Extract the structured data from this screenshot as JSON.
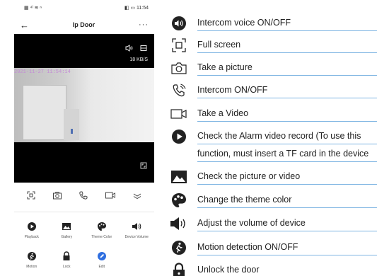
{
  "phone": {
    "status_left": "▦ ⁴ˡ ≋ ⁿ",
    "status_right": "◧ ▭ 11:54",
    "header": {
      "back": "←",
      "title": "Ip Door",
      "more": "···"
    },
    "video": {
      "speed": "18 KB/S",
      "timestamp": "2021-11-27 11:54:14"
    },
    "controls": [
      "fullscreen-icon",
      "camera-icon",
      "phone-icon",
      "video-record-icon",
      "chevron-down-icon"
    ],
    "grid": [
      {
        "label": "Playback",
        "icon": "play-icon"
      },
      {
        "label": "Gallery",
        "icon": "image-icon"
      },
      {
        "label": "Theme Color",
        "icon": "palette-icon"
      },
      {
        "label": "Device Volume",
        "icon": "volume-icon"
      },
      {
        "label": "Motion",
        "icon": "motion-icon"
      },
      {
        "label": "Lock",
        "icon": "lock-icon"
      },
      {
        "label": "Edit",
        "icon": "edit-icon"
      }
    ]
  },
  "legend": {
    "items": [
      {
        "icon": "intercom-voice-icon",
        "label": "Intercom voice ON/OFF"
      },
      {
        "icon": "fullscreen-icon",
        "label": "Full screen"
      },
      {
        "icon": "camera-icon",
        "label": "Take a picture"
      },
      {
        "icon": "intercom-icon",
        "label": "Intercom ON/OFF"
      },
      {
        "icon": "video-icon",
        "label": "Take a Video"
      },
      {
        "icon": "play-icon",
        "label": "Check the Alarm video record (To use this"
      },
      {
        "icon": "",
        "label": "function, must insert a TF card in the device"
      },
      {
        "icon": "image-icon",
        "label": "Check the picture or video"
      },
      {
        "icon": "palette-icon",
        "label": "Change the theme color"
      },
      {
        "icon": "volume-icon",
        "label": "Adjust the volume of device"
      },
      {
        "icon": "motion-icon",
        "label": "Motion detection ON/OFF"
      },
      {
        "icon": "lock-icon",
        "label": "Unlock the door"
      }
    ]
  }
}
